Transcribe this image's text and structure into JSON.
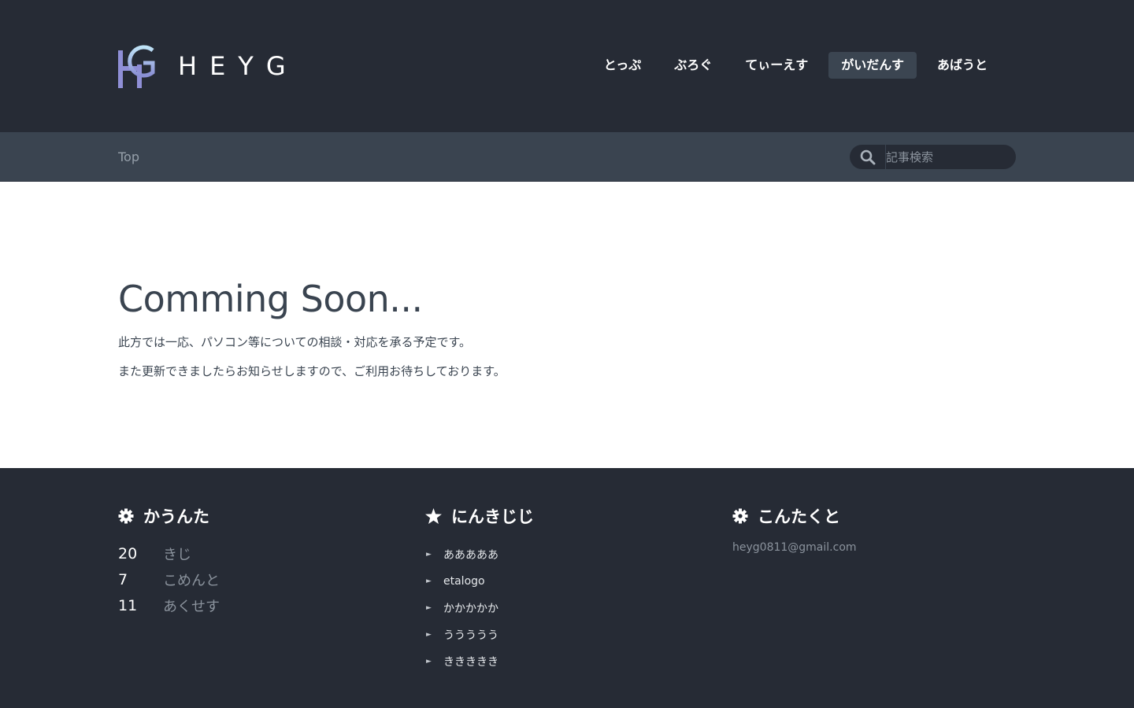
{
  "header": {
    "logo_text": "HEYG",
    "nav": [
      {
        "label": "とっぷ",
        "active": false
      },
      {
        "label": "ぶろぐ",
        "active": false
      },
      {
        "label": "てぃーえす",
        "active": false
      },
      {
        "label": "がいだんす",
        "active": true
      },
      {
        "label": "あばうと",
        "active": false
      }
    ]
  },
  "subbar": {
    "breadcrumb": "Top",
    "search_placeholder": "記事検索"
  },
  "main": {
    "title": "Comming Soon...",
    "paragraphs": [
      "此方では一応、パソコン等についての相談・対応を承る予定です。",
      "また更新できましたらお知らせしますので、ご利用お待ちしております。"
    ]
  },
  "footer": {
    "counter": {
      "title": "かうんた",
      "icon": "gear-icon",
      "stats": [
        {
          "value": "20",
          "label": "きじ"
        },
        {
          "value": "7",
          "label": "こめんと"
        },
        {
          "value": "11",
          "label": "あくせす"
        }
      ]
    },
    "popular": {
      "title": "にんきじじ",
      "icon": "star-icon",
      "items": [
        "あああああ",
        "etalogo",
        "かかかかか",
        "ううううう",
        "ききききき"
      ]
    },
    "contact": {
      "title": "こんたくと",
      "icon": "gear-icon",
      "email": "heyg0811@gmail.com"
    }
  },
  "colors": {
    "header_bg": "#262b35",
    "subbar_bg": "#3a4450",
    "active_nav_bg": "#3b4551",
    "text_dark": "#3a4450",
    "muted": "#8b939d"
  }
}
